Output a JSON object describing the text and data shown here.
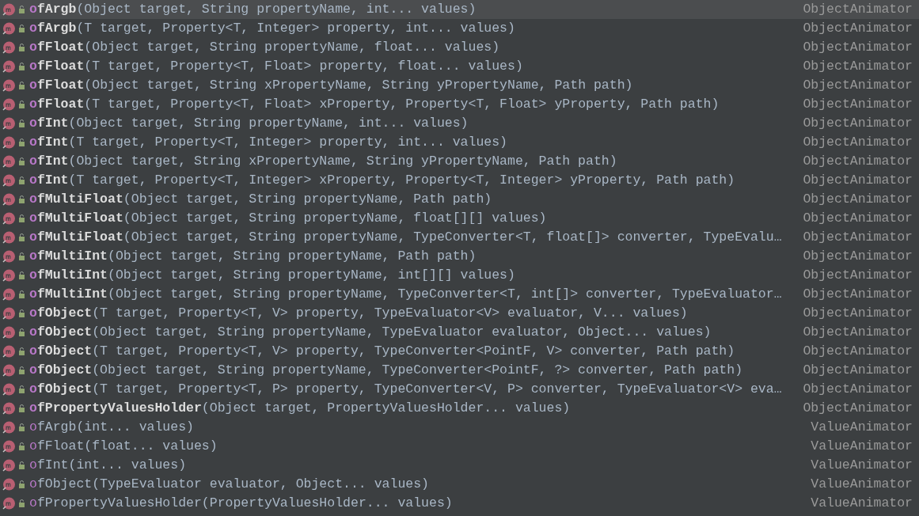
{
  "completions": [
    {
      "match": "o",
      "name": "fArgb",
      "params": "(Object target, String propertyName, int... values)",
      "type": "ObjectAnimator",
      "bold": true,
      "selected": true
    },
    {
      "match": "o",
      "name": "fArgb",
      "params": "(T target, Property<T, Integer> property, int... values)",
      "type": "ObjectAnimator",
      "bold": true,
      "selected": false
    },
    {
      "match": "o",
      "name": "fFloat",
      "params": "(Object target, String propertyName, float... values)",
      "type": "ObjectAnimator",
      "bold": true,
      "selected": false
    },
    {
      "match": "o",
      "name": "fFloat",
      "params": "(T target, Property<T, Float> property, float... values)",
      "type": "ObjectAnimator",
      "bold": true,
      "selected": false
    },
    {
      "match": "o",
      "name": "fFloat",
      "params": "(Object target, String xPropertyName, String yPropertyName, Path path)",
      "type": "ObjectAnimator",
      "bold": true,
      "selected": false
    },
    {
      "match": "o",
      "name": "fFloat",
      "params": "(T target, Property<T, Float> xProperty, Property<T, Float> yProperty, Path path)",
      "type": "ObjectAnimator",
      "bold": true,
      "selected": false
    },
    {
      "match": "o",
      "name": "fInt",
      "params": "(Object target, String propertyName, int... values)",
      "type": "ObjectAnimator",
      "bold": true,
      "selected": false
    },
    {
      "match": "o",
      "name": "fInt",
      "params": "(T target, Property<T, Integer> property, int... values)",
      "type": "ObjectAnimator",
      "bold": true,
      "selected": false
    },
    {
      "match": "o",
      "name": "fInt",
      "params": "(Object target, String xPropertyName, String yPropertyName, Path path)",
      "type": "ObjectAnimator",
      "bold": true,
      "selected": false
    },
    {
      "match": "o",
      "name": "fInt",
      "params": "(T target, Property<T, Integer> xProperty, Property<T, Integer> yProperty, Path path)",
      "type": "ObjectAnimator",
      "bold": true,
      "selected": false
    },
    {
      "match": "o",
      "name": "fMultiFloat",
      "params": "(Object target, String propertyName, Path path)",
      "type": "ObjectAnimator",
      "bold": true,
      "selected": false
    },
    {
      "match": "o",
      "name": "fMultiFloat",
      "params": "(Object target, String propertyName, float[][] values)",
      "type": "ObjectAnimator",
      "bold": true,
      "selected": false
    },
    {
      "match": "o",
      "name": "fMultiFloat",
      "params": "(Object target, String propertyName, TypeConverter<T, float[]> converter, TypeEvalu…",
      "type": "ObjectAnimator",
      "bold": true,
      "selected": false
    },
    {
      "match": "o",
      "name": "fMultiInt",
      "params": "(Object target, String propertyName, Path path)",
      "type": "ObjectAnimator",
      "bold": true,
      "selected": false
    },
    {
      "match": "o",
      "name": "fMultiInt",
      "params": "(Object target, String propertyName, int[][] values)",
      "type": "ObjectAnimator",
      "bold": true,
      "selected": false
    },
    {
      "match": "o",
      "name": "fMultiInt",
      "params": "(Object target, String propertyName, TypeConverter<T, int[]> converter, TypeEvaluator…",
      "type": "ObjectAnimator",
      "bold": true,
      "selected": false
    },
    {
      "match": "o",
      "name": "fObject",
      "params": "(T target, Property<T, V> property, TypeEvaluator<V> evaluator, V... values)",
      "type": "ObjectAnimator",
      "bold": true,
      "selected": false
    },
    {
      "match": "o",
      "name": "fObject",
      "params": "(Object target, String propertyName, TypeEvaluator evaluator, Object... values)",
      "type": "ObjectAnimator",
      "bold": true,
      "selected": false
    },
    {
      "match": "o",
      "name": "fObject",
      "params": "(T target, Property<T, V> property, TypeConverter<PointF, V> converter, Path path)",
      "type": "ObjectAnimator",
      "bold": true,
      "selected": false
    },
    {
      "match": "o",
      "name": "fObject",
      "params": "(Object target, String propertyName, TypeConverter<PointF, ?> converter, Path path)",
      "type": "ObjectAnimator",
      "bold": true,
      "selected": false
    },
    {
      "match": "o",
      "name": "fObject",
      "params": "(T target, Property<T, P> property, TypeConverter<V, P> converter, TypeEvaluator<V> eva…",
      "type": "ObjectAnimator",
      "bold": true,
      "selected": false
    },
    {
      "match": "o",
      "name": "fPropertyValuesHolder",
      "params": "(Object target, PropertyValuesHolder... values)",
      "type": "ObjectAnimator",
      "bold": true,
      "selected": false
    },
    {
      "match": "o",
      "name": "fArgb",
      "params": "(int... values)",
      "type": "ValueAnimator",
      "bold": false,
      "selected": false
    },
    {
      "match": "o",
      "name": "fFloat",
      "params": "(float... values)",
      "type": "ValueAnimator",
      "bold": false,
      "selected": false
    },
    {
      "match": "o",
      "name": "fInt",
      "params": "(int... values)",
      "type": "ValueAnimator",
      "bold": false,
      "selected": false
    },
    {
      "match": "o",
      "name": "fObject",
      "params": "(TypeEvaluator evaluator, Object... values)",
      "type": "ValueAnimator",
      "bold": false,
      "selected": false
    },
    {
      "match": "o",
      "name": "fPropertyValuesHolder",
      "params": "(PropertyValuesHolder... values)",
      "type": "ValueAnimator",
      "bold": false,
      "selected": false
    }
  ]
}
